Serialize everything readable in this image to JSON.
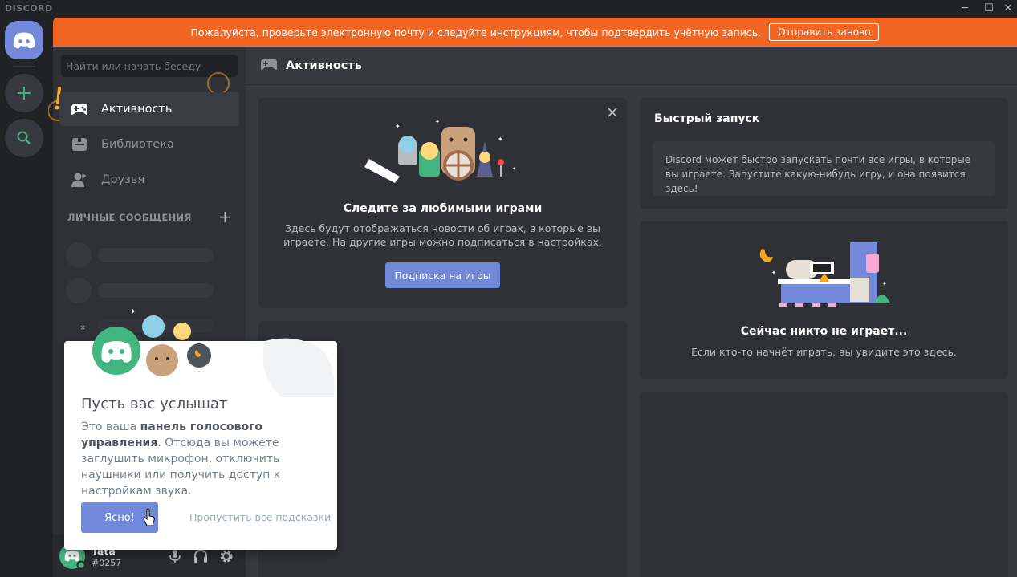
{
  "app": {
    "brand": "DISCORD"
  },
  "banner": {
    "text": "Пожалуйста, проверьте электронную почту и следуйте инструкциям, чтобы подтвердить учётную запись.",
    "button": "Отправить заново"
  },
  "sidebar": {
    "search_placeholder": "Найти или начать беседу",
    "items": [
      {
        "label": "Активность",
        "icon": "gamepad-icon",
        "active": true
      },
      {
        "label": "Библиотека",
        "icon": "library-icon",
        "active": false
      },
      {
        "label": "Друзья",
        "icon": "friends-icon",
        "active": false
      }
    ],
    "dm_header": "ЛИЧНЫЕ СООБЩЕНИЯ"
  },
  "user": {
    "name": "Tata",
    "tag": "#0257"
  },
  "main": {
    "title": "Активность",
    "follow_card": {
      "title": "Следите за любимыми играми",
      "desc_line1": "Здесь будут отображаться новости об играх, в которые вы",
      "desc_line2": "играете. На другие игры можно подписаться в настройках.",
      "button": "Подписка на игры"
    },
    "quick_launch": {
      "title": "Быстрый запуск",
      "desc": "Discord может быстро запускать почти все игры, в которые вы играете. Запустите какую-нибудь игру, и она появится здесь!"
    },
    "now_playing": {
      "title": "Сейчас никто не играет...",
      "desc": "Если кто-то начнёт играть, вы увидите это здесь."
    }
  },
  "popout": {
    "title": "Пусть вас услышат",
    "body_prefix": "Это ваша ",
    "body_bold": "панель голосового управления",
    "body_rest": ". Отсюда вы можете заглушить микрофон, отключить наушники или получить доступ к настройкам звука.",
    "ok": "Ясно!",
    "skip": "Пропустить все подсказки"
  },
  "colors": {
    "blurple": "#7289da",
    "orange": "#f26522",
    "green": "#43b581"
  }
}
